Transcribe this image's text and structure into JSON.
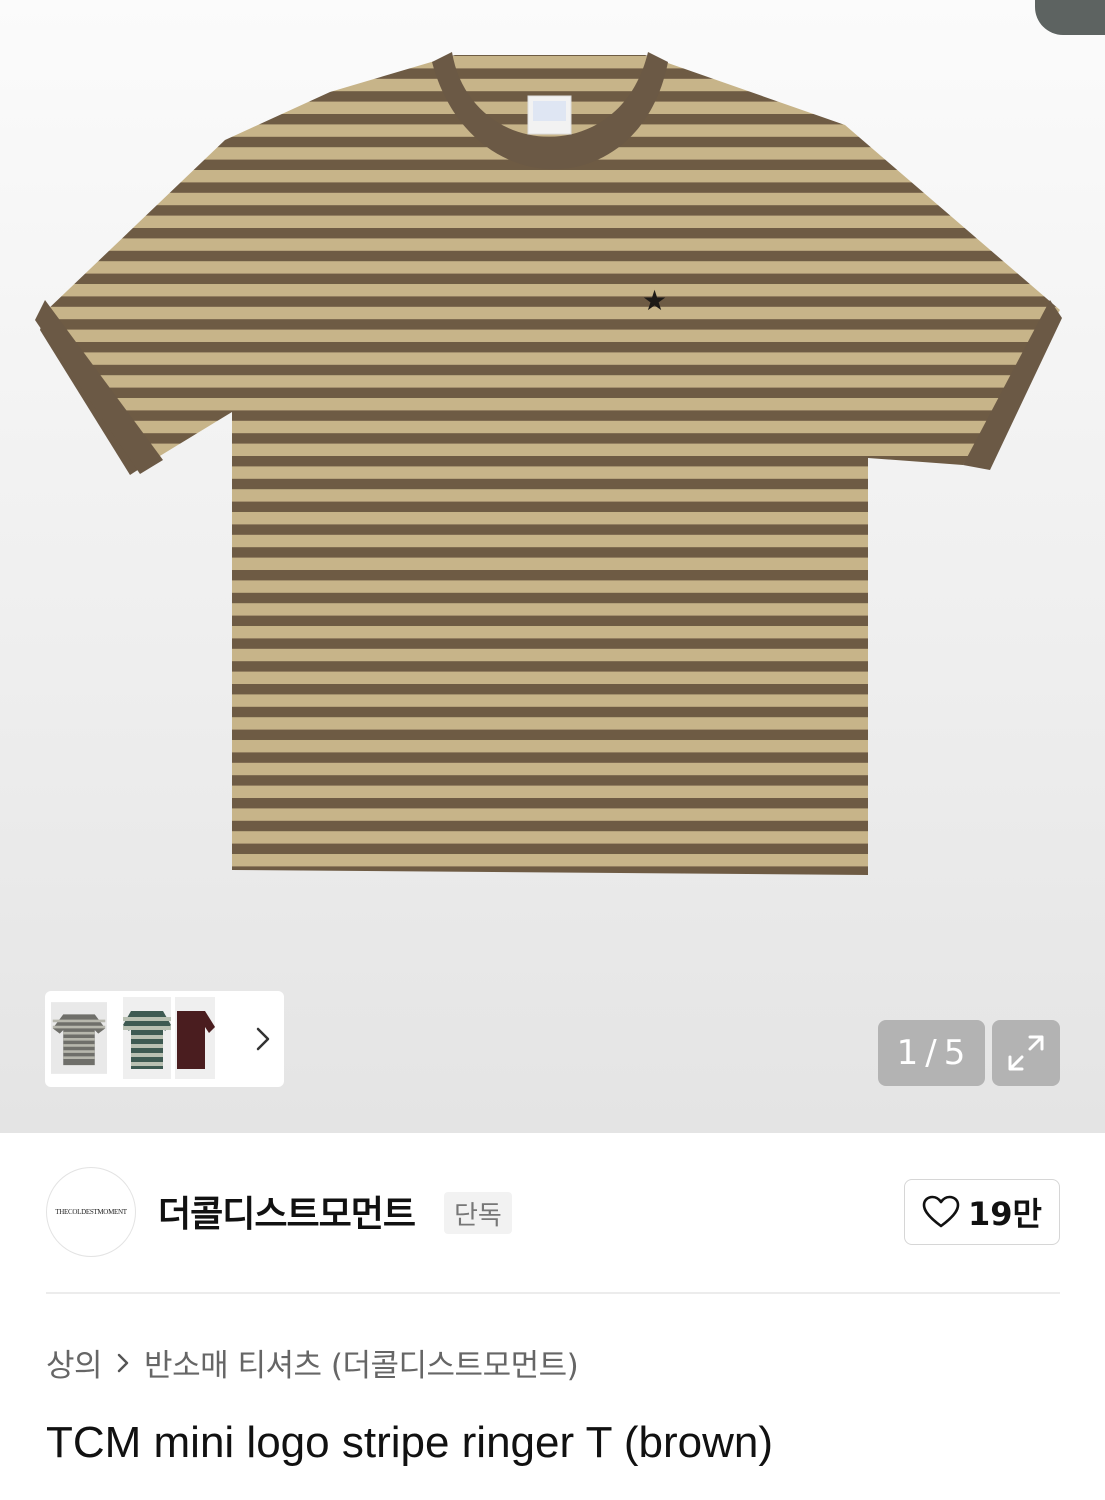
{
  "gallery": {
    "counter_current": "1",
    "counter_sep": "/",
    "counter_total": "5",
    "expand_icon": "expand-arrows-icon",
    "next_icon": "chevron-right-icon",
    "thumbnails": [
      {
        "name": "thumb-gray-stripe",
        "colors": [
          "#6f6f6a",
          "#b7b7ad"
        ]
      },
      {
        "name": "thumb-green-stripe",
        "colors": [
          "#3e5a52",
          "#b9c0b2"
        ]
      },
      {
        "name": "thumb-burgundy",
        "colors": [
          "#4a1d1f",
          "#5b2527"
        ]
      }
    ]
  },
  "product_image": {
    "shirt_dark": "#6e5b44",
    "shirt_light": "#c7b489",
    "rib_color": "#6b5945"
  },
  "brand": {
    "logo_text": "THECOLDESTMOMENT",
    "name": "더콜디스트모먼트",
    "badge": "단독",
    "likes": "19만",
    "like_icon": "heart-icon"
  },
  "breadcrumb": {
    "category": "상의",
    "subcategory": "반소매 티셔츠 (더콜디스트모먼트)",
    "separator_icon": "chevron-right-icon"
  },
  "product": {
    "title": "TCM mini logo stripe ringer T (brown)"
  }
}
